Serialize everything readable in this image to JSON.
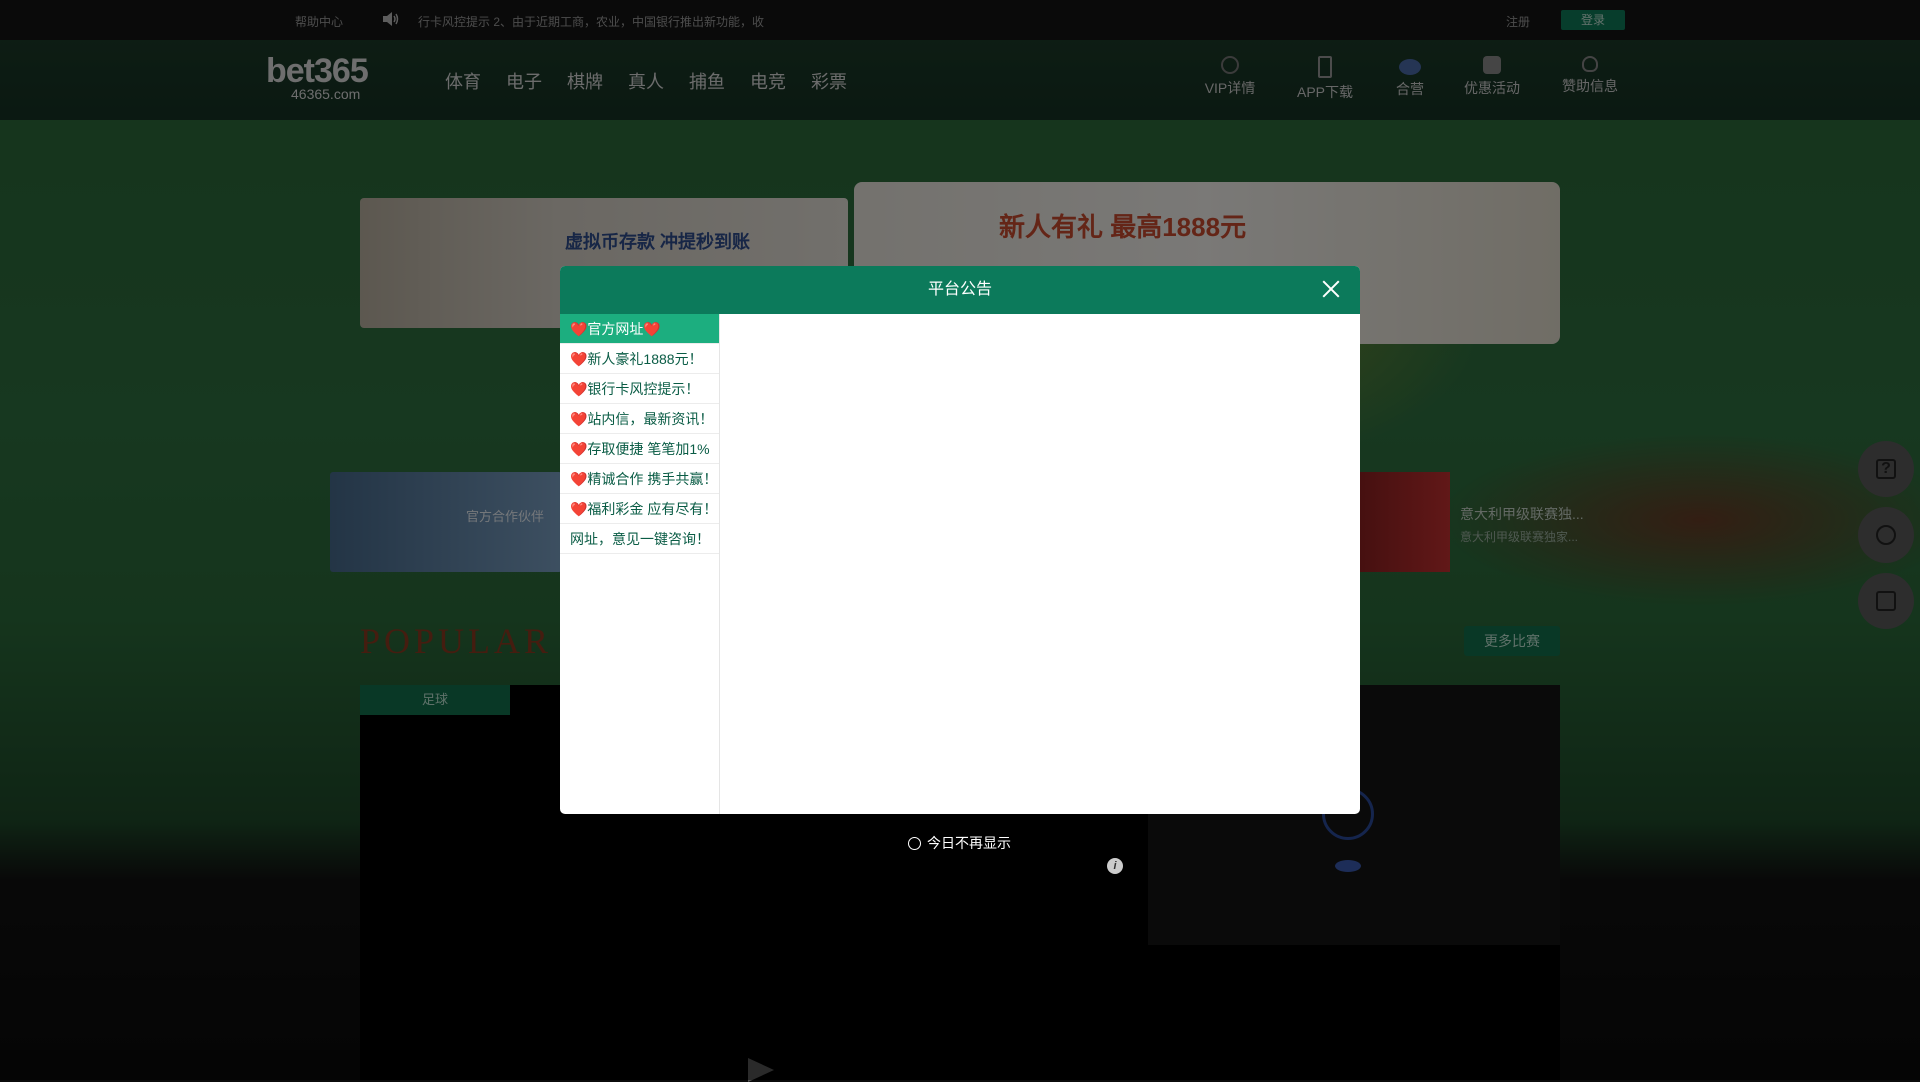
{
  "topbar": {
    "help": "帮助中心",
    "marquee": "行卡风控提示    2、由于近期工商，农业，中国银行推出新功能，收",
    "register": "注册",
    "login": "登录"
  },
  "logo": {
    "name": "bet365",
    "domain": "46365.com"
  },
  "nav": [
    "体育",
    "电子",
    "棋牌",
    "真人",
    "捕鱼",
    "电竞",
    "彩票"
  ],
  "right_nav": [
    {
      "label": "VIP详情",
      "icon": "vip-icon"
    },
    {
      "label": "APP下载",
      "icon": "phone-icon"
    },
    {
      "label": "合营",
      "icon": "eye-icon"
    },
    {
      "label": "优惠活动",
      "icon": "gift-icon"
    },
    {
      "label": "赞助信息",
      "icon": "trophy-icon"
    }
  ],
  "banners": {
    "left": "虚拟币存款 冲提秒到账",
    "right": "新人有礼 最高1888元"
  },
  "cards": {
    "left": "官方合作伙伴"
  },
  "match": {
    "title": "意大利甲级联赛独...",
    "subtitle": "意大利甲级联赛独家..."
  },
  "section": {
    "title": "POPULAR",
    "more": "更多比赛",
    "tab": "足球"
  },
  "modal": {
    "title": "平台公告",
    "items": [
      "❤️官方网址❤️",
      "❤️新人豪礼1888元！",
      "❤️银行卡风控提示！",
      "❤️站内信，最新资讯！",
      "❤️存取便捷 笔笔加1%",
      "❤️精诚合作 携手共赢！",
      "❤️福利彩金 应有尽有！",
      "网址，意见一键咨询！"
    ],
    "active_index": 0,
    "dont_show": "今日不再显示"
  },
  "colors": {
    "brand": "#0c7a5b",
    "active": "#1cae7f"
  }
}
